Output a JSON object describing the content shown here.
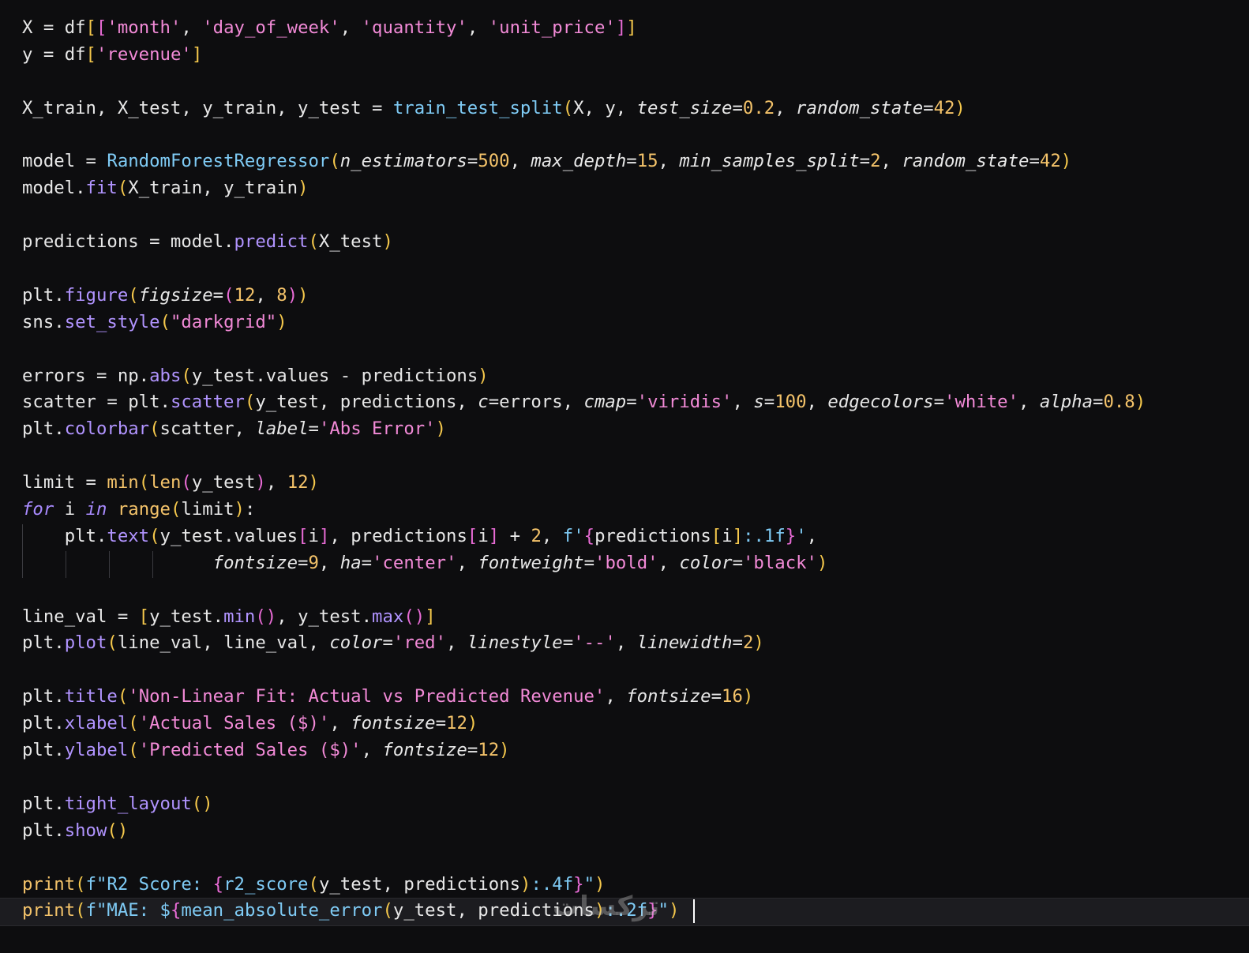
{
  "editor": {
    "lines": [
      [
        [
          "v",
          "X = df"
        ],
        [
          "b",
          "["
        ],
        [
          "b2",
          "["
        ],
        [
          "s",
          "'month'"
        ],
        [
          "v",
          ", "
        ],
        [
          "s",
          "'day_of_week'"
        ],
        [
          "v",
          ", "
        ],
        [
          "s",
          "'quantity'"
        ],
        [
          "v",
          ", "
        ],
        [
          "s",
          "'unit_price'"
        ],
        [
          "b2",
          "]"
        ],
        [
          "b",
          "]"
        ]
      ],
      [
        [
          "v",
          "y = df"
        ],
        [
          "b",
          "["
        ],
        [
          "s",
          "'revenue'"
        ],
        [
          "b",
          "]"
        ]
      ],
      [],
      [
        [
          "v",
          "X_train, X_test, y_train, y_test = "
        ],
        [
          "m",
          "train_test_split"
        ],
        [
          "b",
          "("
        ],
        [
          "v",
          "X, y, "
        ],
        [
          "p",
          "test_size"
        ],
        [
          "v",
          "="
        ],
        [
          "n",
          "0.2"
        ],
        [
          "v",
          ", "
        ],
        [
          "p",
          "random_state"
        ],
        [
          "v",
          "="
        ],
        [
          "n",
          "42"
        ],
        [
          "b",
          ")"
        ]
      ],
      [],
      [
        [
          "v",
          "model = "
        ],
        [
          "m",
          "RandomForestRegressor"
        ],
        [
          "b",
          "("
        ],
        [
          "p",
          "n_estimators"
        ],
        [
          "v",
          "="
        ],
        [
          "n",
          "500"
        ],
        [
          "v",
          ", "
        ],
        [
          "p",
          "max_depth"
        ],
        [
          "v",
          "="
        ],
        [
          "n",
          "15"
        ],
        [
          "v",
          ", "
        ],
        [
          "p",
          "min_samples_split"
        ],
        [
          "v",
          "="
        ],
        [
          "n",
          "2"
        ],
        [
          "v",
          ", "
        ],
        [
          "p",
          "random_state"
        ],
        [
          "v",
          "="
        ],
        [
          "n",
          "42"
        ],
        [
          "b",
          ")"
        ]
      ],
      [
        [
          "v",
          "model."
        ],
        [
          "f",
          "fit"
        ],
        [
          "b",
          "("
        ],
        [
          "v",
          "X_train, y_train"
        ],
        [
          "b",
          ")"
        ]
      ],
      [],
      [
        [
          "v",
          "predictions = model."
        ],
        [
          "f",
          "predict"
        ],
        [
          "b",
          "("
        ],
        [
          "v",
          "X_test"
        ],
        [
          "b",
          ")"
        ]
      ],
      [],
      [
        [
          "v",
          "plt."
        ],
        [
          "f",
          "figure"
        ],
        [
          "b",
          "("
        ],
        [
          "p",
          "figsize"
        ],
        [
          "v",
          "="
        ],
        [
          "b2",
          "("
        ],
        [
          "n",
          "12"
        ],
        [
          "v",
          ", "
        ],
        [
          "n",
          "8"
        ],
        [
          "b2",
          ")"
        ],
        [
          "b",
          ")"
        ]
      ],
      [
        [
          "v",
          "sns."
        ],
        [
          "f",
          "set_style"
        ],
        [
          "b",
          "("
        ],
        [
          "s",
          "\"darkgrid\""
        ],
        [
          "b",
          ")"
        ]
      ],
      [],
      [
        [
          "v",
          "errors = np."
        ],
        [
          "f",
          "abs"
        ],
        [
          "b",
          "("
        ],
        [
          "v",
          "y_test.values - predictions"
        ],
        [
          "b",
          ")"
        ]
      ],
      [
        [
          "v",
          "scatter = plt."
        ],
        [
          "f",
          "scatter"
        ],
        [
          "b",
          "("
        ],
        [
          "v",
          "y_test, predictions, "
        ],
        [
          "p",
          "c"
        ],
        [
          "v",
          "=errors, "
        ],
        [
          "p",
          "cmap"
        ],
        [
          "v",
          "="
        ],
        [
          "s",
          "'viridis'"
        ],
        [
          "v",
          ", "
        ],
        [
          "p",
          "s"
        ],
        [
          "v",
          "="
        ],
        [
          "n",
          "100"
        ],
        [
          "v",
          ", "
        ],
        [
          "p",
          "edgecolors"
        ],
        [
          "v",
          "="
        ],
        [
          "s",
          "'white'"
        ],
        [
          "v",
          ", "
        ],
        [
          "p",
          "alpha"
        ],
        [
          "v",
          "="
        ],
        [
          "n",
          "0.8"
        ],
        [
          "b",
          ")"
        ]
      ],
      [
        [
          "v",
          "plt."
        ],
        [
          "f",
          "colorbar"
        ],
        [
          "b",
          "("
        ],
        [
          "v",
          "scatter, "
        ],
        [
          "p",
          "label"
        ],
        [
          "v",
          "="
        ],
        [
          "s",
          "'Abs Error'"
        ],
        [
          "b",
          ")"
        ]
      ],
      [],
      [
        [
          "v",
          "limit = "
        ],
        [
          "bi",
          "min"
        ],
        [
          "b",
          "("
        ],
        [
          "bi",
          "len"
        ],
        [
          "b2",
          "("
        ],
        [
          "v",
          "y_test"
        ],
        [
          "b2",
          ")"
        ],
        [
          "v",
          ", "
        ],
        [
          "n",
          "12"
        ],
        [
          "b",
          ")"
        ]
      ],
      [
        [
          "k",
          "for"
        ],
        [
          "v",
          " i "
        ],
        [
          "k",
          "in"
        ],
        [
          "v",
          " "
        ],
        [
          "bi",
          "range"
        ],
        [
          "b",
          "("
        ],
        [
          "v",
          "limit"
        ],
        [
          "b",
          ")"
        ],
        [
          "v",
          ":"
        ]
      ],
      [
        [
          "v",
          "    plt."
        ],
        [
          "f",
          "text"
        ],
        [
          "b",
          "("
        ],
        [
          "v",
          "y_test.values"
        ],
        [
          "b2",
          "["
        ],
        [
          "v",
          "i"
        ],
        [
          "b2",
          "]"
        ],
        [
          "v",
          ", predictions"
        ],
        [
          "b2",
          "["
        ],
        [
          "v",
          "i"
        ],
        [
          "b2",
          "]"
        ],
        [
          "v",
          " + "
        ],
        [
          "n",
          "2"
        ],
        [
          "v",
          ", "
        ],
        [
          "m",
          "f'"
        ],
        [
          "b2",
          "{"
        ],
        [
          "v",
          "predictions"
        ],
        [
          "b",
          "["
        ],
        [
          "v",
          "i"
        ],
        [
          "b",
          "]"
        ],
        [
          "m",
          ":.1f"
        ],
        [
          "b2",
          "}"
        ],
        [
          "m",
          "'"
        ],
        [
          "v",
          ","
        ]
      ],
      [
        [
          "v",
          "                  "
        ],
        [
          "p",
          "fontsize"
        ],
        [
          "v",
          "="
        ],
        [
          "n",
          "9"
        ],
        [
          "v",
          ", "
        ],
        [
          "p",
          "ha"
        ],
        [
          "v",
          "="
        ],
        [
          "s",
          "'center'"
        ],
        [
          "v",
          ", "
        ],
        [
          "p",
          "fontweight"
        ],
        [
          "v",
          "="
        ],
        [
          "s",
          "'bold'"
        ],
        [
          "v",
          ", "
        ],
        [
          "p",
          "color"
        ],
        [
          "v",
          "="
        ],
        [
          "s",
          "'black'"
        ],
        [
          "b",
          ")"
        ]
      ],
      [],
      [
        [
          "v",
          "line_val = "
        ],
        [
          "b",
          "["
        ],
        [
          "v",
          "y_test."
        ],
        [
          "f",
          "min"
        ],
        [
          "b2",
          "()"
        ],
        [
          "v",
          ", y_test."
        ],
        [
          "f",
          "max"
        ],
        [
          "b2",
          "()"
        ],
        [
          "b",
          "]"
        ]
      ],
      [
        [
          "v",
          "plt."
        ],
        [
          "f",
          "plot"
        ],
        [
          "b",
          "("
        ],
        [
          "v",
          "line_val, line_val, "
        ],
        [
          "p",
          "color"
        ],
        [
          "v",
          "="
        ],
        [
          "s",
          "'red'"
        ],
        [
          "v",
          ", "
        ],
        [
          "p",
          "linestyle"
        ],
        [
          "v",
          "="
        ],
        [
          "s",
          "'--'"
        ],
        [
          "v",
          ", "
        ],
        [
          "p",
          "linewidth"
        ],
        [
          "v",
          "="
        ],
        [
          "n",
          "2"
        ],
        [
          "b",
          ")"
        ]
      ],
      [],
      [
        [
          "v",
          "plt."
        ],
        [
          "f",
          "title"
        ],
        [
          "b",
          "("
        ],
        [
          "s",
          "'Non-Linear Fit: Actual vs Predicted Revenue'"
        ],
        [
          "v",
          ", "
        ],
        [
          "p",
          "fontsize"
        ],
        [
          "v",
          "="
        ],
        [
          "n",
          "16"
        ],
        [
          "b",
          ")"
        ]
      ],
      [
        [
          "v",
          "plt."
        ],
        [
          "f",
          "xlabel"
        ],
        [
          "b",
          "("
        ],
        [
          "s",
          "'Actual Sales ($)'"
        ],
        [
          "v",
          ", "
        ],
        [
          "p",
          "fontsize"
        ],
        [
          "v",
          "="
        ],
        [
          "n",
          "12"
        ],
        [
          "b",
          ")"
        ]
      ],
      [
        [
          "v",
          "plt."
        ],
        [
          "f",
          "ylabel"
        ],
        [
          "b",
          "("
        ],
        [
          "s",
          "'Predicted Sales ($)'"
        ],
        [
          "v",
          ", "
        ],
        [
          "p",
          "fontsize"
        ],
        [
          "v",
          "="
        ],
        [
          "n",
          "12"
        ],
        [
          "b",
          ")"
        ]
      ],
      [],
      [
        [
          "v",
          "plt."
        ],
        [
          "f",
          "tight_layout"
        ],
        [
          "b",
          "()"
        ]
      ],
      [
        [
          "v",
          "plt."
        ],
        [
          "f",
          "show"
        ],
        [
          "b",
          "()"
        ]
      ],
      [],
      [
        [
          "bi",
          "print"
        ],
        [
          "b",
          "("
        ],
        [
          "m",
          "f\"R2 Score: "
        ],
        [
          "b2",
          "{"
        ],
        [
          "m",
          "r2_score"
        ],
        [
          "b",
          "("
        ],
        [
          "v",
          "y_test, predictions"
        ],
        [
          "b",
          ")"
        ],
        [
          "m",
          ":.4f"
        ],
        [
          "b2",
          "}"
        ],
        [
          "m",
          "\""
        ],
        [
          "b",
          ")"
        ]
      ],
      [
        [
          "bi",
          "print"
        ],
        [
          "b",
          "("
        ],
        [
          "m",
          "f\"MAE: $"
        ],
        [
          "b2",
          "{"
        ],
        [
          "m",
          "mean_absolute_error"
        ],
        [
          "b",
          "("
        ],
        [
          "v",
          "y_test, predictions"
        ],
        [
          "b",
          ")"
        ],
        [
          "m",
          ":.2f"
        ],
        [
          "b2",
          "}"
        ],
        [
          "m",
          "\""
        ],
        [
          "b",
          ")"
        ]
      ]
    ]
  },
  "watermark": {
    "text": "ترکسات"
  }
}
